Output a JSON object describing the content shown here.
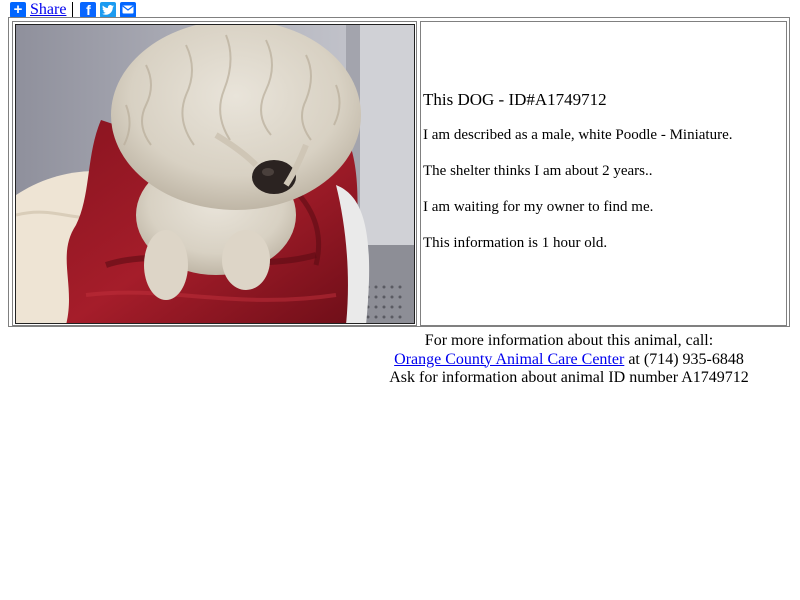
{
  "share_bar": {
    "share_label": "Share",
    "icons": [
      "share-plus-icon",
      "facebook-icon",
      "twitter-icon",
      "email-icon"
    ],
    "colors": {
      "share": "#0166ff",
      "facebook": "#0866ff",
      "twitter": "#1d9bf0",
      "email": "#0166ff"
    }
  },
  "animal": {
    "photo_subject": "dog",
    "headline_prefix": "This DOG - ",
    "headline_id": "ID#A1749712",
    "description": "I am described as a male, white Poodle - Miniature.",
    "age": "The shelter thinks I am about 2 years..",
    "status": "I am waiting for my owner to find me.",
    "freshness": "This information is 1 hour old."
  },
  "contact": {
    "intro": "For more information about this animal, call:",
    "shelter_name": "Orange County Animal Care Center",
    "phone_text": " at (714) 935-6848",
    "ask_text": "Ask for information about animal ID number A1749712"
  }
}
